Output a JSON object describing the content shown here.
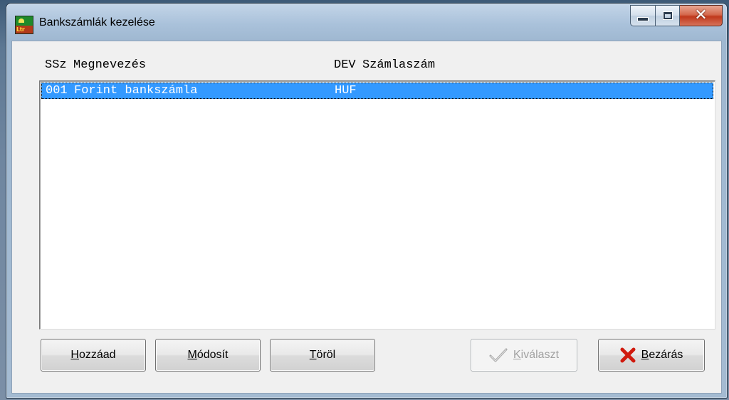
{
  "window": {
    "title": "Bankszámlák kezelése",
    "close_glyph": "✕"
  },
  "list": {
    "columns": [
      "SSz",
      "Megnevezés",
      "DEV",
      "Számlaszám"
    ],
    "rows": [
      {
        "ssz": "001",
        "name": "Forint bankszámla",
        "dev": "HUF",
        "account": ""
      }
    ],
    "selected_index": 0
  },
  "buttons": {
    "add": {
      "accel": "H",
      "rest": "ozzáad"
    },
    "edit": {
      "accel": "M",
      "rest": "ódosít"
    },
    "delete": {
      "accel": "T",
      "rest": "öröl"
    },
    "select": {
      "accel": "K",
      "rest": "iválaszt",
      "enabled": false
    },
    "close": {
      "accel": "B",
      "rest": "ezárás"
    }
  },
  "colors": {
    "selection": "#3399ff",
    "close_x": "#d01a0e",
    "check_disabled": "#a8a8a8"
  },
  "icons": {
    "app": "app-logo-icon",
    "minimize": "minimize-icon",
    "maximize": "maximize-icon",
    "close": "close-icon",
    "select": "checkmark-icon",
    "close_button": "red-x-icon"
  }
}
